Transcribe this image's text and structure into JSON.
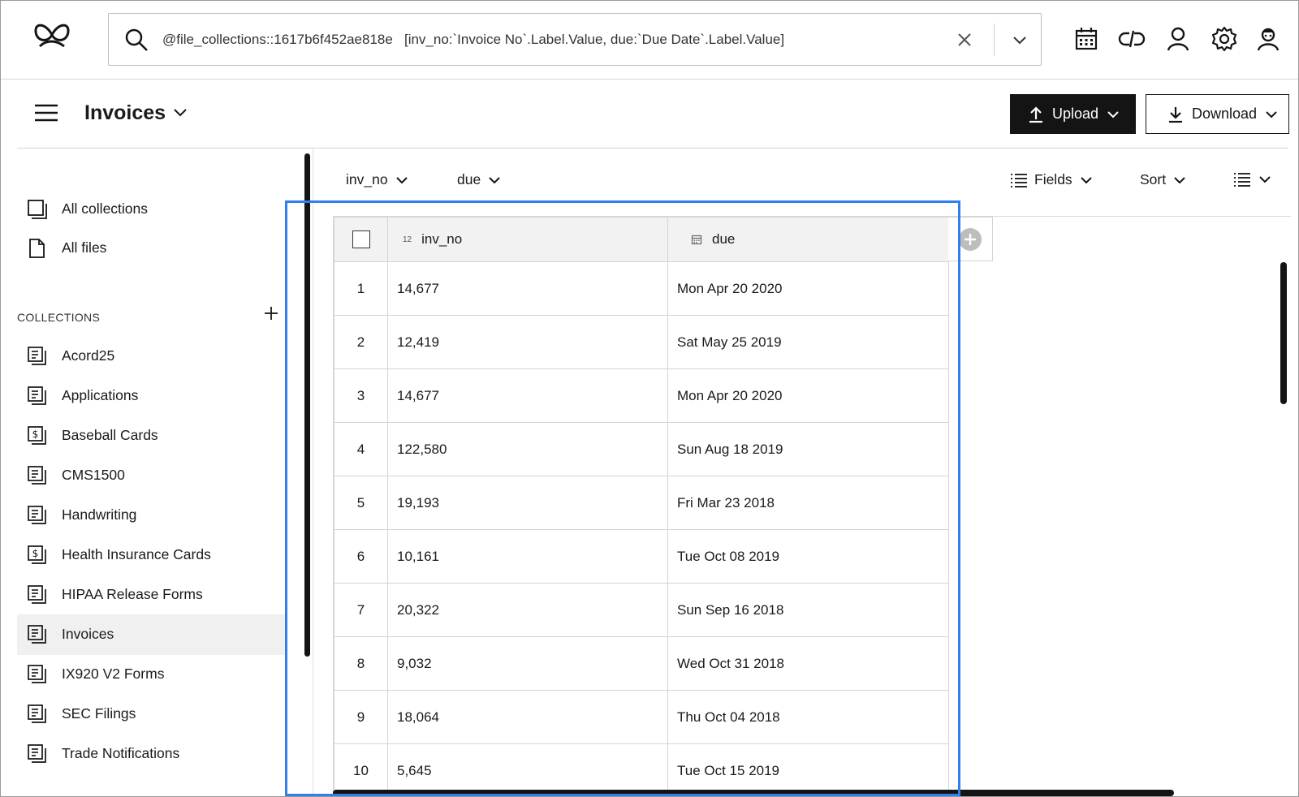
{
  "search": {
    "query": "@file_collections::1617b6f452ae818e   [inv_no:`Invoice No`.Label.Value, due:`Due Date`.Label.Value]"
  },
  "top_icons": [
    "calendar-icon",
    "link-icon",
    "user-icon",
    "gear-icon",
    "agent-icon"
  ],
  "header": {
    "title": "Invoices",
    "upload_label": "Upload",
    "download_label": "Download"
  },
  "sidebar": {
    "top_items": [
      {
        "label": "All collections",
        "icon": "collections-icon"
      },
      {
        "label": "All files",
        "icon": "file-icon"
      }
    ],
    "collections_heading": "COLLECTIONS",
    "collections": [
      {
        "label": "Acord25",
        "icon": "collection-icon"
      },
      {
        "label": "Applications",
        "icon": "collection-icon"
      },
      {
        "label": "Baseball Cards",
        "icon": "collection-dollar-icon"
      },
      {
        "label": "CMS1500",
        "icon": "collection-icon"
      },
      {
        "label": "Handwriting",
        "icon": "collection-icon"
      },
      {
        "label": "Health Insurance Cards",
        "icon": "collection-dollar-icon"
      },
      {
        "label": "HIPAA Release Forms",
        "icon": "collection-icon"
      },
      {
        "label": "Invoices",
        "icon": "collection-icon",
        "active": true
      },
      {
        "label": "IX920 V2 Forms",
        "icon": "collection-icon"
      },
      {
        "label": "SEC Filings",
        "icon": "collection-icon"
      },
      {
        "label": "Trade Notifications",
        "icon": "collection-icon"
      }
    ]
  },
  "toolbar": {
    "filter1": "inv_no",
    "filter2": "due",
    "fields_label": "Fields",
    "sort_label": "Sort"
  },
  "table": {
    "columns": [
      {
        "name": "inv_no",
        "type_badge": "12"
      },
      {
        "name": "due",
        "type_badge": "calendar"
      }
    ],
    "rows": [
      {
        "idx": "1",
        "inv_no": "14,677",
        "due": "Mon Apr 20 2020"
      },
      {
        "idx": "2",
        "inv_no": "12,419",
        "due": "Sat May 25 2019"
      },
      {
        "idx": "3",
        "inv_no": "14,677",
        "due": "Mon Apr 20 2020"
      },
      {
        "idx": "4",
        "inv_no": "122,580",
        "due": "Sun Aug 18 2019"
      },
      {
        "idx": "5",
        "inv_no": "19,193",
        "due": "Fri Mar 23 2018"
      },
      {
        "idx": "6",
        "inv_no": "10,161",
        "due": "Tue Oct 08 2019"
      },
      {
        "idx": "7",
        "inv_no": "20,322",
        "due": "Sun Sep 16 2018"
      },
      {
        "idx": "8",
        "inv_no": "9,032",
        "due": "Wed Oct 31 2018"
      },
      {
        "idx": "9",
        "inv_no": "18,064",
        "due": "Thu Oct 04 2018"
      },
      {
        "idx": "10",
        "inv_no": "5,645",
        "due": "Tue Oct 15 2019"
      }
    ]
  },
  "colors": {
    "highlight": "#2f80ed",
    "primary_button": "#141414",
    "header_bg": "#f2f2f2",
    "active_item_bg": "#f0f0f0"
  }
}
